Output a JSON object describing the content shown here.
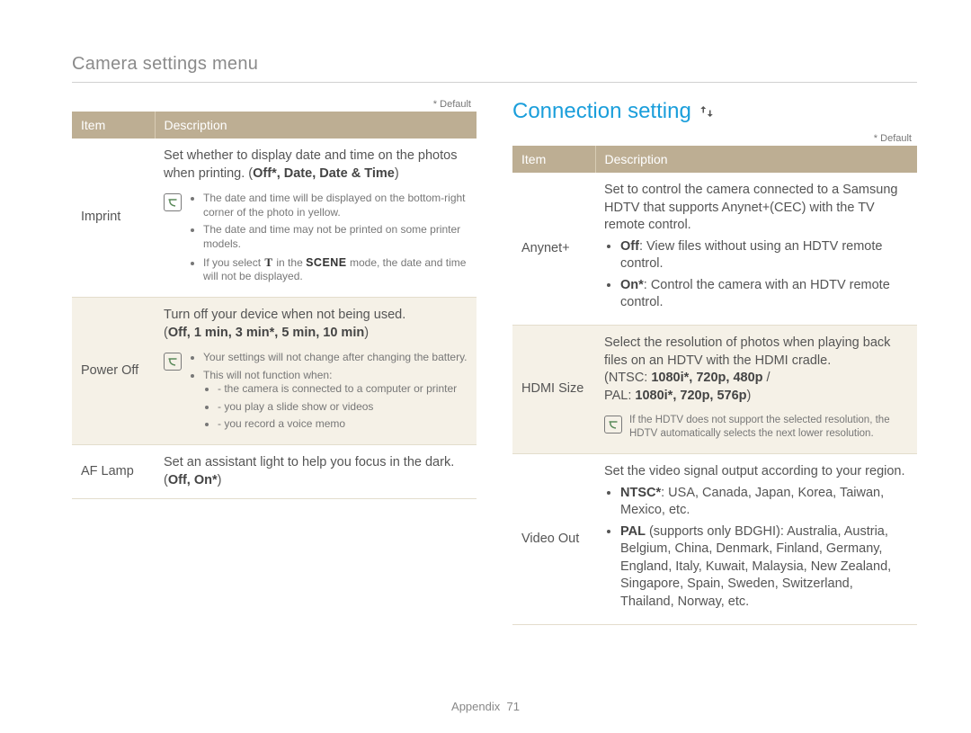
{
  "page": {
    "breadcrumb": "Camera settings menu",
    "footer_label": "Appendix",
    "footer_page": "71"
  },
  "left": {
    "default_label": "* Default",
    "header_item": "Item",
    "header_desc": "Description",
    "rows": {
      "imprint": {
        "label": "Imprint",
        "desc": "Set whether to display date and time on the photos when printing. (",
        "opts": "Off*, Date, Date & Time",
        "desc_close": ")",
        "note1": "The date and time will be displayed on the bottom-right corner of the photo in yellow.",
        "note2": "The date and time may not be printed on some printer models.",
        "note3a": "If you select ",
        "note3b": " in the ",
        "note3c": " mode, the date and time will not be displayed.",
        "scene": "SCENE"
      },
      "poweroff": {
        "label": "Power Off",
        "desc": "Turn off your device when not being used.",
        "opts": "Off, 1 min, 3 min*, 5 min, 10 min",
        "note1": "Your settings will not change after changing the battery.",
        "note2": "This will not function when:",
        "sub1": "the camera is connected to a computer or printer",
        "sub2": "you play a slide show or videos",
        "sub3": "you record a voice memo"
      },
      "aflamp": {
        "label": "AF Lamp",
        "desc": "Set an assistant light to help you focus in the dark.",
        "opts": "Off, On*"
      }
    }
  },
  "right": {
    "title": "Connection setting",
    "default_label": "* Default",
    "header_item": "Item",
    "header_desc": "Description",
    "rows": {
      "anynet": {
        "label": "Anynet+",
        "desc": "Set to control the camera connected to a Samsung HDTV that supports Anynet+(CEC) with the TV remote control.",
        "b1a": "Off",
        "b1b": ": View files without using an HDTV remote control.",
        "b2a": "On*",
        "b2b": ": Control the camera with an HDTV remote control."
      },
      "hdmi": {
        "label": "HDMI Size",
        "desc": "Select the resolution of photos when playing back files on an HDTV with the HDMI cradle.",
        "l1": "(NTSC: ",
        "l1b": "1080i*, 720p, 480p",
        "l1c": " /",
        "l2": "PAL: ",
        "l2b": "1080i*, 720p, 576p",
        "l2c": ")",
        "note": "If the HDTV does not support the selected resolution, the HDTV automatically selects the next lower resolution."
      },
      "video": {
        "label": "Video Out",
        "desc": "Set the video signal output according to your region.",
        "b1a": "NTSC*",
        "b1b": ": USA, Canada, Japan, Korea, Taiwan, Mexico, etc.",
        "b2a": "PAL",
        "b2b": " (supports only BDGHI): Australia, Austria, Belgium, China, Denmark, Finland, Germany, England, Italy, Kuwait, Malaysia, New Zealand, Singapore, Spain, Sweden, Switzerland, Thailand, Norway, etc."
      }
    }
  }
}
